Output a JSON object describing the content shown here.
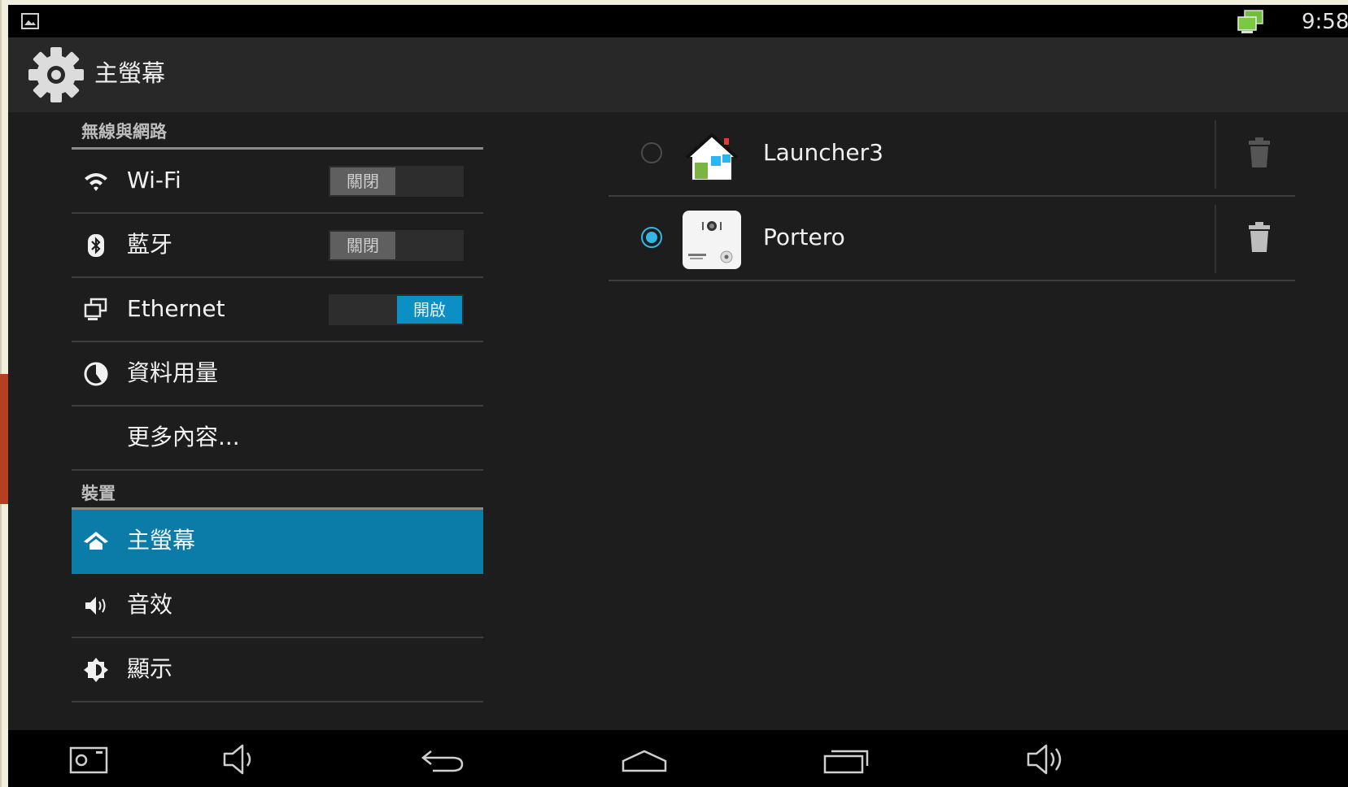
{
  "status_bar": {
    "time": "9:58"
  },
  "action_bar": {
    "title": "主螢幕"
  },
  "menu": {
    "category_wireless": "無線與網路",
    "wifi": {
      "label": "Wi-Fi",
      "toggle": "關閉"
    },
    "bluetooth": {
      "label": "藍牙",
      "toggle": "關閉"
    },
    "ethernet": {
      "label": "Ethernet",
      "toggle": "開啟"
    },
    "data_usage": {
      "label": "資料用量"
    },
    "more": {
      "label": "更多內容..."
    },
    "category_device": "裝置",
    "home": {
      "label": "主螢幕"
    },
    "sound": {
      "label": "音效"
    },
    "display": {
      "label": "顯示"
    }
  },
  "home_apps": [
    {
      "label": "Launcher3",
      "selected": false,
      "icon": "launcher3-house-icon"
    },
    {
      "label": "Portero",
      "selected": true,
      "icon": "portero-app-icon"
    }
  ],
  "colors": {
    "accent": "#0b7ca8",
    "radio": "#33b5e5",
    "toggle_on": "#0c8fc4"
  }
}
